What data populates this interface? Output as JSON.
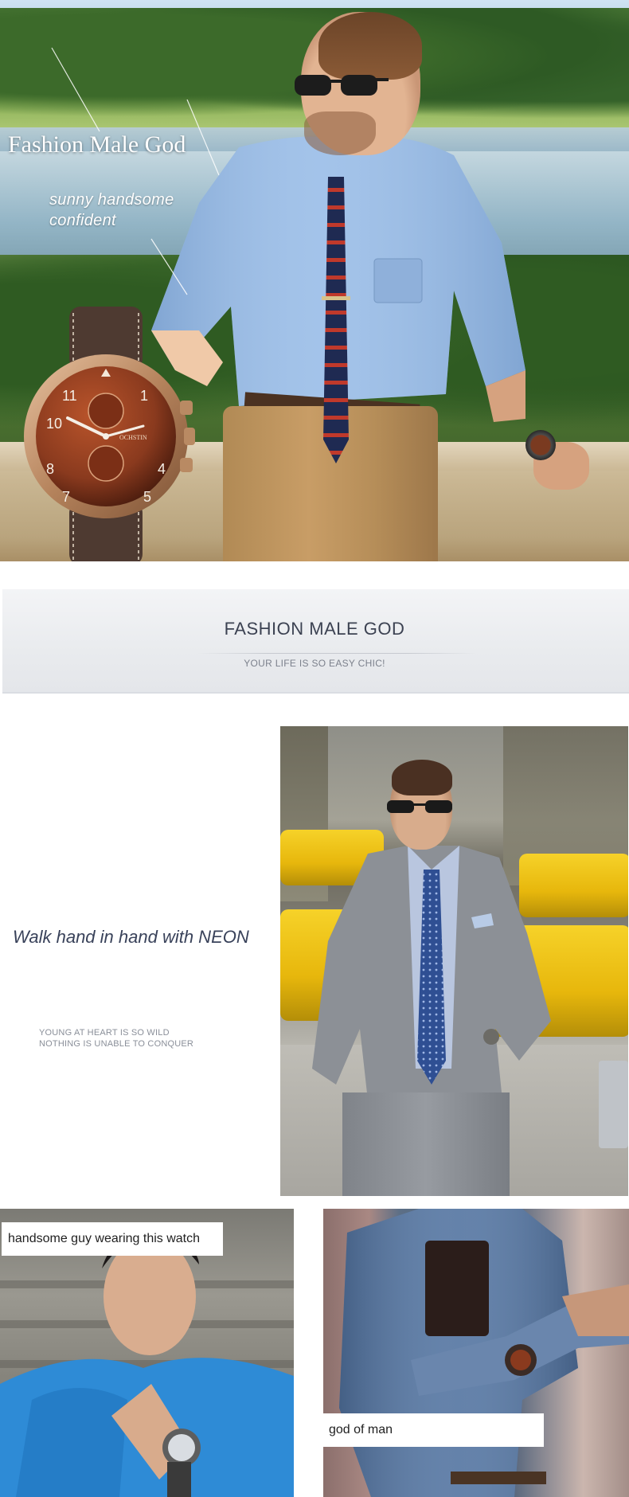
{
  "hero": {
    "title": "Fashion Male God",
    "subtitle_line1": "sunny handsome",
    "subtitle_line2": "confident",
    "watch_brand": "OCHSTIN",
    "dial_numbers": [
      "11",
      "1",
      "10",
      "8",
      "7",
      "5",
      "4"
    ]
  },
  "banner": {
    "title": "FASHION MALE GOD",
    "subtitle": "YOUR LIFE IS SO EASY CHIC!"
  },
  "neon": {
    "heading": "Walk hand in hand with NEON",
    "quote_line1": "YOUNG AT HEART IS SO WILD",
    "quote_line2": "NOTHING IS UNABLE TO CONQUER"
  },
  "tiles": {
    "left_caption": "handsome guy wearing this watch",
    "right_caption": "god of man"
  },
  "colors": {
    "accent_text": "#3c4252",
    "dial": "#8a3a1e",
    "case": "#c79a72",
    "strap": "#4e3a31",
    "shirt_blue": "#9dbfe8",
    "taxi_yellow": "#f2c81c"
  }
}
